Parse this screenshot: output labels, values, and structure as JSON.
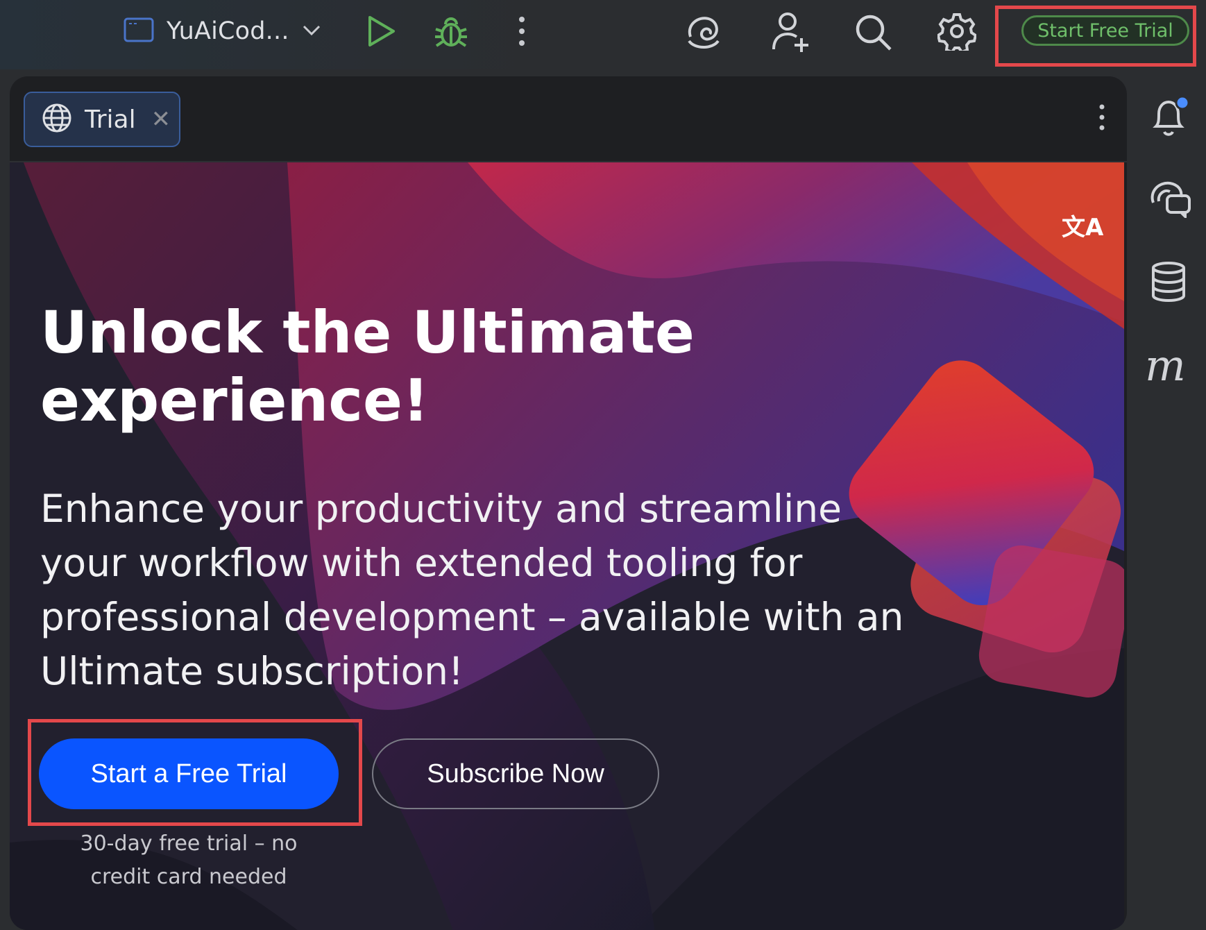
{
  "toolbar": {
    "project_name": "YuAiCod...",
    "start_free_trial": "Start Free Trial",
    "icons": [
      "window-icon",
      "chevron-down-icon",
      "run-icon",
      "debug-icon",
      "more-vertical-icon",
      "ai-swirl-icon",
      "add-user-icon",
      "search-icon",
      "settings-icon"
    ]
  },
  "tab": {
    "label": "Trial",
    "close": "✕",
    "icon": "globe-icon"
  },
  "hero": {
    "translate_glyph": "文A",
    "headline_line1": "Unlock the Ultimate",
    "headline_line2": "experience!",
    "body_line1": "Enhance your productivity and streamline",
    "body_line2": "your workflow with extended tooling for",
    "body_line3": "professional development – available with an",
    "body_line4": "Ultimate subscription!",
    "primary_button": "Start a Free Trial",
    "secondary_button": "Subscribe Now",
    "note_line1": "30-day free trial – no",
    "note_line2": "credit card needed"
  },
  "rightbar": {
    "icons": [
      "notification-bell-icon",
      "ai-chat-icon",
      "database-icon",
      "m-plugin-icon"
    ],
    "m_glyph": "m"
  },
  "colors": {
    "accent_blue": "#0a55ff",
    "trial_green": "#6fbf6a",
    "highlight_red": "#e4484b",
    "notification_dot": "#4a8dff"
  }
}
